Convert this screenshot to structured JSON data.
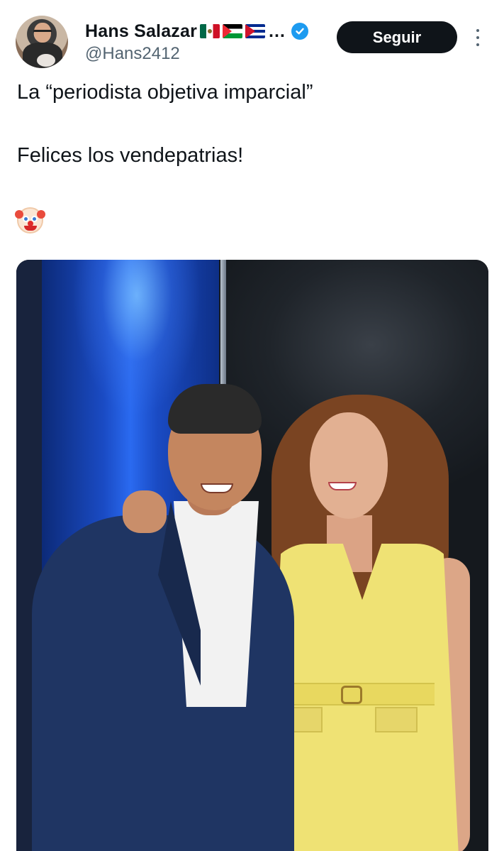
{
  "author": {
    "display_name": "Hans Salazar",
    "flags": [
      "mexico-flag",
      "palestine-flag",
      "cuba-flag"
    ],
    "name_truncation": "…",
    "handle": "@Hans2412",
    "verified": true
  },
  "actions": {
    "follow_label": "Seguir",
    "more_icon": "more-vertical-icon"
  },
  "tweet": {
    "line1": "La “periodista objetiva imparcial”",
    "line2": "Felices los vendepatrias!",
    "emoji": "clown-face-emoji"
  },
  "colors": {
    "text": "#0f1419",
    "secondary_text": "#536471",
    "follow_bg": "#0f1419",
    "verified": "#1d9bf0"
  }
}
